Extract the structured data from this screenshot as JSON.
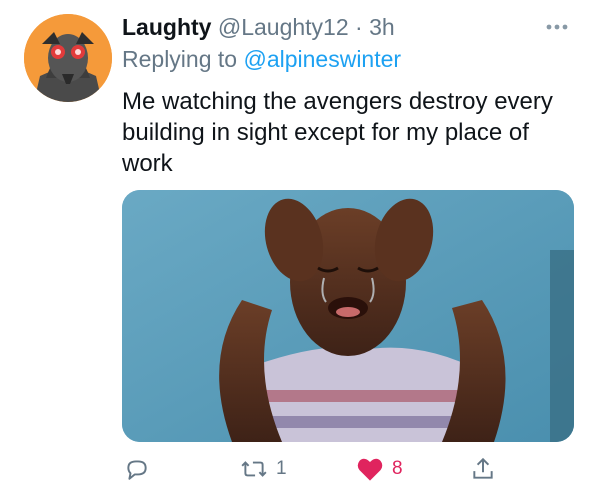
{
  "tweet": {
    "display_name": "Laughty",
    "handle": "@Laughty12",
    "separator": "·",
    "time": "3h",
    "replying_prefix": "Replying to",
    "replying_handle": "@alpineswinter",
    "text": "Me watching the avengers destroy every building in sight except for my place of work",
    "avatar_icon": "cartoon-avatar-icon",
    "more_icon": "more-dots-icon",
    "media_alt_icon": "crying-kid-photo"
  },
  "actions": {
    "reply_icon": "reply-icon",
    "retweet_icon": "retweet-icon",
    "retweet_count": "1",
    "like_icon": "heart-icon",
    "like_count": "8",
    "share_icon": "share-icon"
  },
  "colors": {
    "accent": "#1da1f2",
    "muted": "#657786",
    "like": "#e0245e",
    "text": "#0f1419"
  }
}
